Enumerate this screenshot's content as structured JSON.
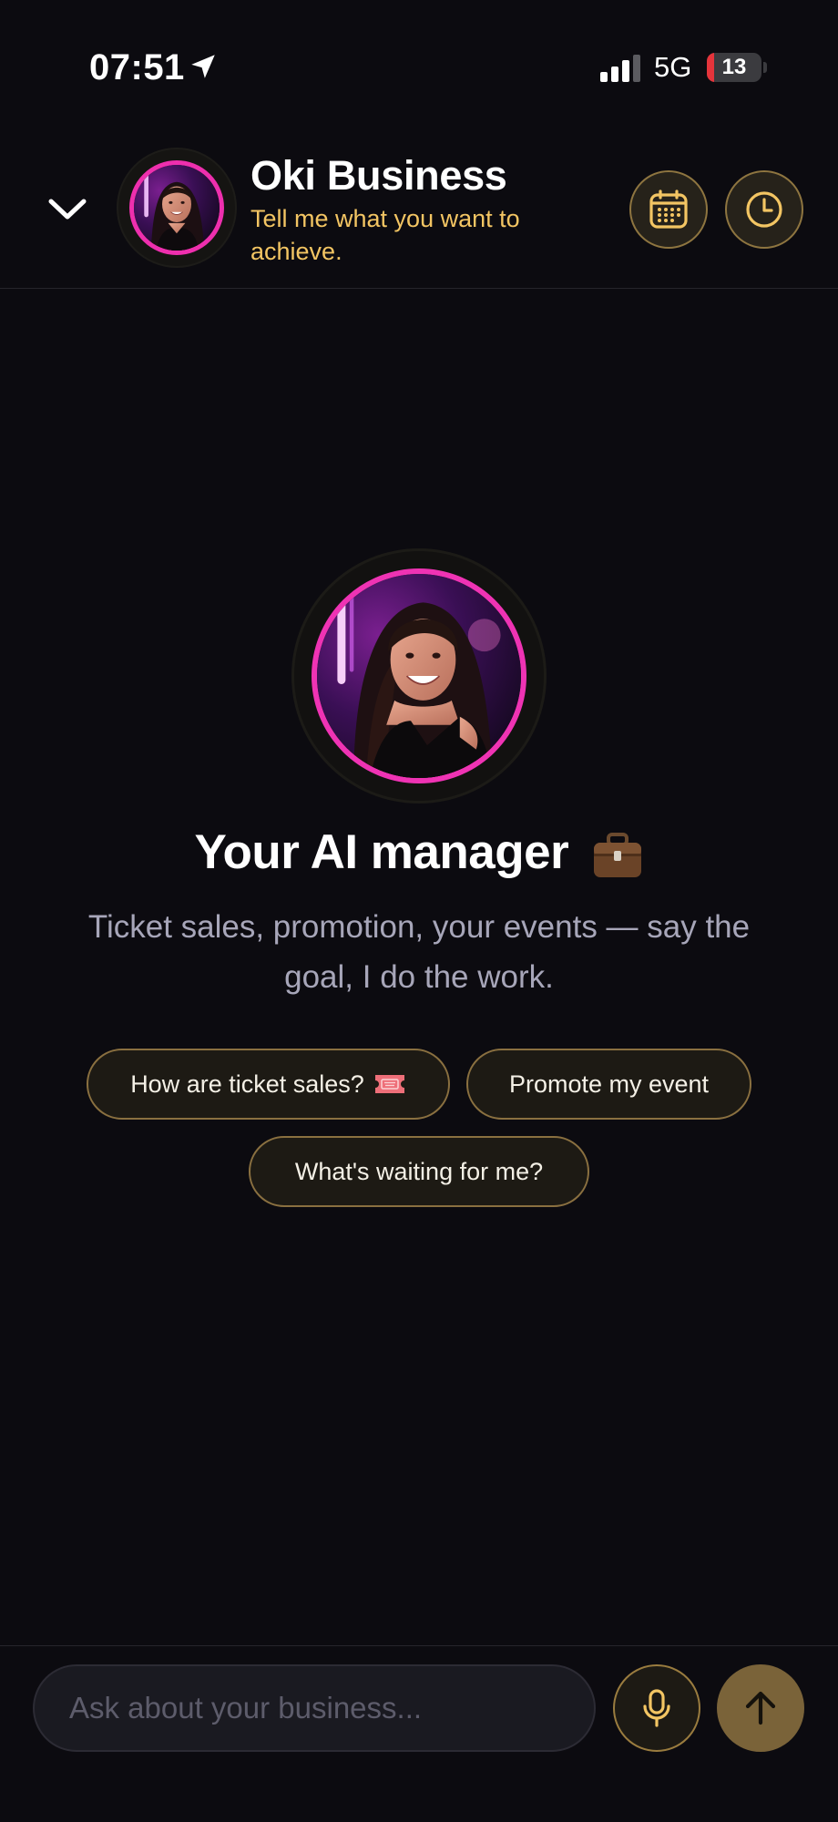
{
  "status_bar": {
    "time": "07:51",
    "network": "5G",
    "battery": "13",
    "battery_level": 0.13,
    "icons": [
      "location-arrow-icon",
      "signal-bars-icon",
      "battery-icon"
    ]
  },
  "header": {
    "title": "Oki Business",
    "subtitle": "Tell me what you want to achieve.",
    "icons": [
      "chevron-down-icon",
      "avatar",
      "calendar-icon",
      "clock-icon"
    ]
  },
  "hero": {
    "title": "Your AI manager",
    "title_icon": "briefcase-icon",
    "description": "Ticket sales, promotion, your events — say the goal, I do the work."
  },
  "suggestions": [
    {
      "label": "How are ticket sales?",
      "icon": "ticket-icon"
    },
    {
      "label": "Promote my event"
    },
    {
      "label": "What's waiting for me?"
    }
  ],
  "composer": {
    "placeholder": "Ask about your business...",
    "icons": [
      "microphone-icon",
      "arrow-up-icon"
    ]
  },
  "colors": {
    "background": "#0c0b10",
    "accent_gold": "#f3c563",
    "avatar_ring_pink": "#ee2fae",
    "chip_border": "#8a7040",
    "send_button": "#7a6339"
  }
}
